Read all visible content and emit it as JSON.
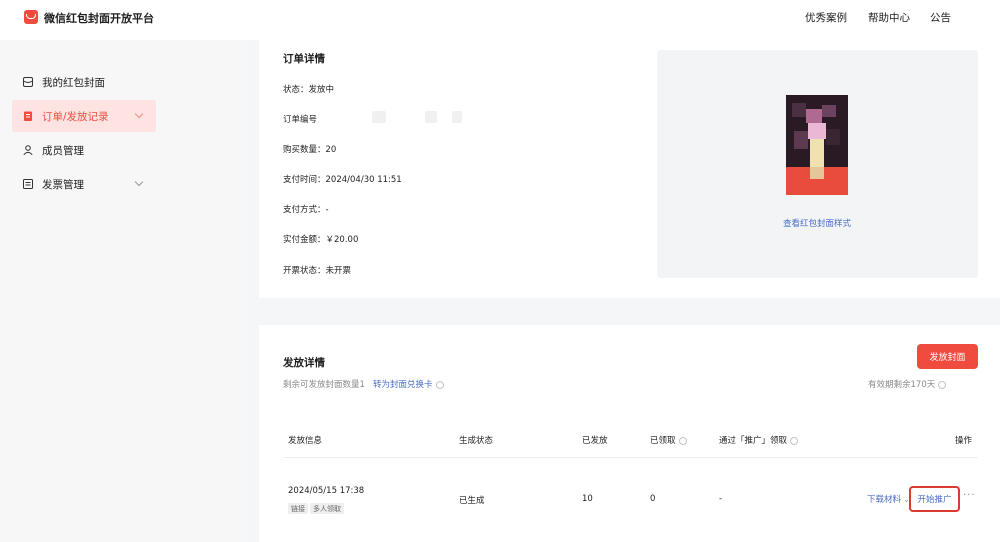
{
  "header": {
    "brand": "微信红包封面开放平台",
    "nav": [
      "优秀案例",
      "帮助中心",
      "公告"
    ]
  },
  "sidebar": {
    "items": [
      {
        "label": "我的红包封面",
        "icon": "cover-icon",
        "active": false,
        "expandable": false
      },
      {
        "label": "订单/发放记录",
        "icon": "order-icon",
        "active": true,
        "expandable": true
      },
      {
        "label": "成员管理",
        "icon": "member-icon",
        "active": false,
        "expandable": false
      },
      {
        "label": "发票管理",
        "icon": "invoice-icon",
        "active": false,
        "expandable": true
      }
    ]
  },
  "order": {
    "title": "订单详情",
    "fields": [
      {
        "label": "状态：",
        "value": "发放中"
      },
      {
        "label": "订单编号",
        "value": ""
      },
      {
        "label": "购买数量：",
        "value": "20"
      },
      {
        "label": "支付时间：",
        "value": "2024/04/30 11:51"
      },
      {
        "label": "支付方式：",
        "value": "-"
      },
      {
        "label": "实付金额：",
        "value": "￥20.00"
      },
      {
        "label": "开票状态：",
        "value": "未开票"
      }
    ],
    "preview_link": "查看红包封面样式"
  },
  "distribution": {
    "title": "发放详情",
    "remaining": "剩余可发放封面数量1",
    "convert_link": "转为封面兑换卡",
    "validity": "有效期剩余170天",
    "issue_button": "发放封面",
    "columns": [
      "发放信息",
      "生成状态",
      "已发放",
      "已领取",
      "通过「推广」领取",
      "操作"
    ],
    "rows": [
      {
        "date": "2024/05/15 17:38",
        "tags": [
          "链接",
          "多人领取"
        ],
        "status": "已生成",
        "issued": "10",
        "claimed": "0",
        "promo_claimed": "-",
        "download": "下载材料",
        "promote": "开始推广",
        "more": "···"
      }
    ]
  },
  "colors": {
    "accent": "#f04b3f",
    "link": "#4a6ec5",
    "active_bg": "#fde4e2"
  }
}
